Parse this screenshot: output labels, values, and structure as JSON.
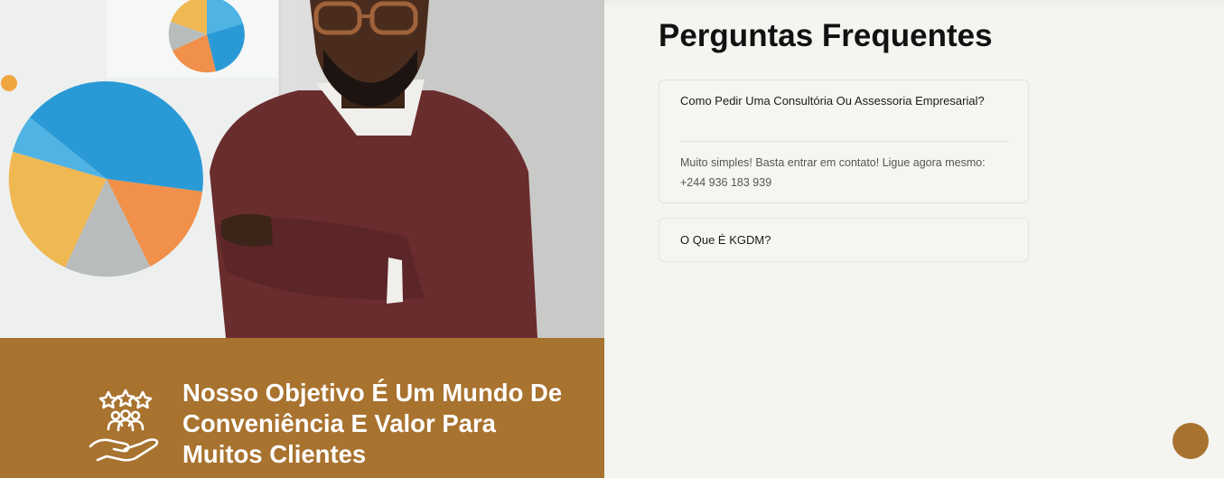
{
  "banner": {
    "text": "Nosso Objetivo É Um Mundo De Conveniência E Valor Para Muitos Clientes",
    "icon": "customer-review-hand-icon"
  },
  "faq": {
    "title": "Perguntas Frequentes",
    "items": [
      {
        "question": "Como Pedir Uma Consultória Ou Assessoria Empresarial?",
        "answer": "Muito simples! Basta entrar em contato! Ligue agora mesmo: +244 936 183 939",
        "expanded": true
      },
      {
        "question": "O Que É KGDM?",
        "expanded": false
      }
    ]
  },
  "colors": {
    "accent": "#a8722f",
    "background": "#f4f4f1"
  }
}
